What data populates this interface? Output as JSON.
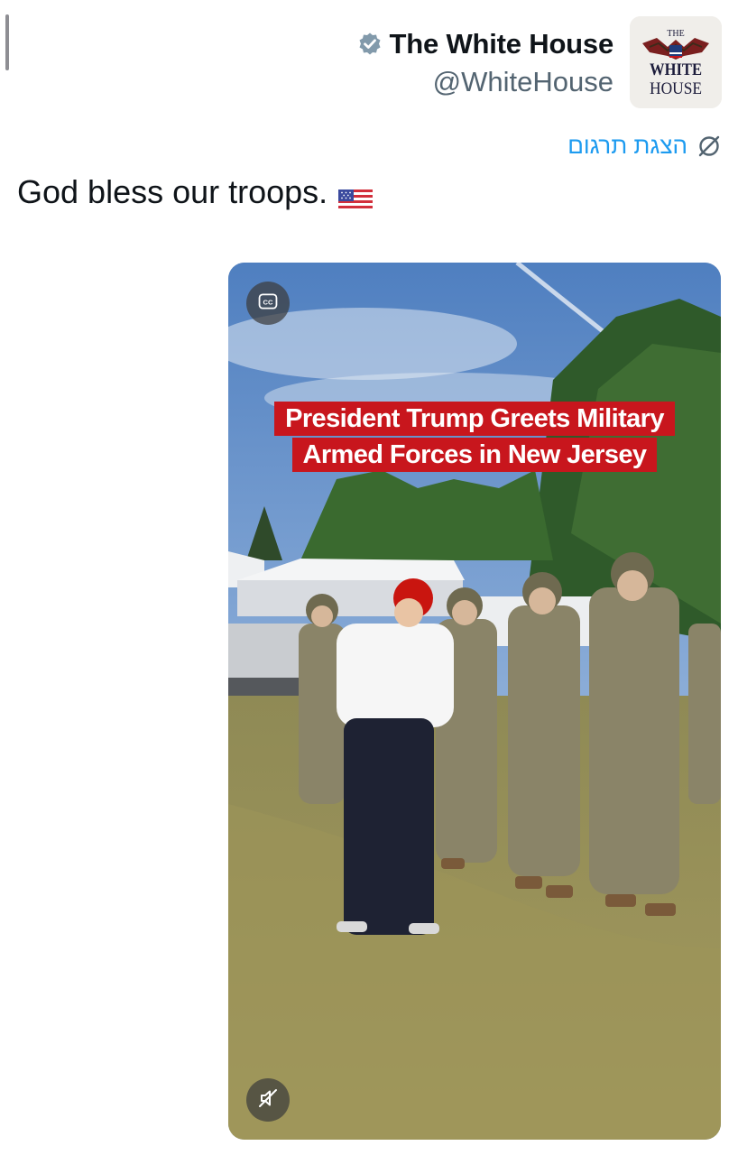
{
  "account": {
    "display_name": "The White House",
    "handle": "@WhiteHouse",
    "verified_icon": "verified-badge-icon",
    "avatar_lines": [
      "THE",
      "WHITE",
      "HOUSE"
    ]
  },
  "translate": {
    "label": "הצגת תרגום",
    "icon": "globe-slash-icon"
  },
  "tweet": {
    "text": "God bless our troops.",
    "emoji_icon": "us-flag-icon"
  },
  "media": {
    "type": "video",
    "caption_lines": [
      "President Trump Greets Military",
      "Armed Forces in New Jersey"
    ],
    "cc_label": "CC",
    "mute_icon": "muted-speaker-icon"
  },
  "colors": {
    "accent": "#1d9bf0",
    "caption_bg": "#c8161d",
    "handle": "#536471"
  }
}
